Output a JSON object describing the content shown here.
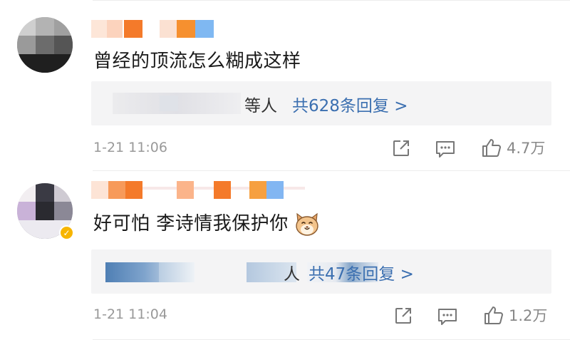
{
  "comments": [
    {
      "text": "曾经的顶流怎么糊成这样",
      "reply_suffix": "等人",
      "reply_count_label": "共628条回复 >",
      "time": "1-21 11:06",
      "likes": "4.7万",
      "verified": false
    },
    {
      "text": "好可怕 李诗情我保护你",
      "emoji": "cat-emoji",
      "reply_suffix": "人",
      "reply_count_label": "共47条回复 >",
      "time": "1-21 11:04",
      "likes": "1.2万",
      "verified": true
    }
  ],
  "icons": [
    "share-icon",
    "comment-icon",
    "like-icon"
  ],
  "colors": {
    "link": "#3b6fb0",
    "meta": "#999999",
    "verify_badge": "#f7b500",
    "reply_bg": "#f4f4f5"
  }
}
